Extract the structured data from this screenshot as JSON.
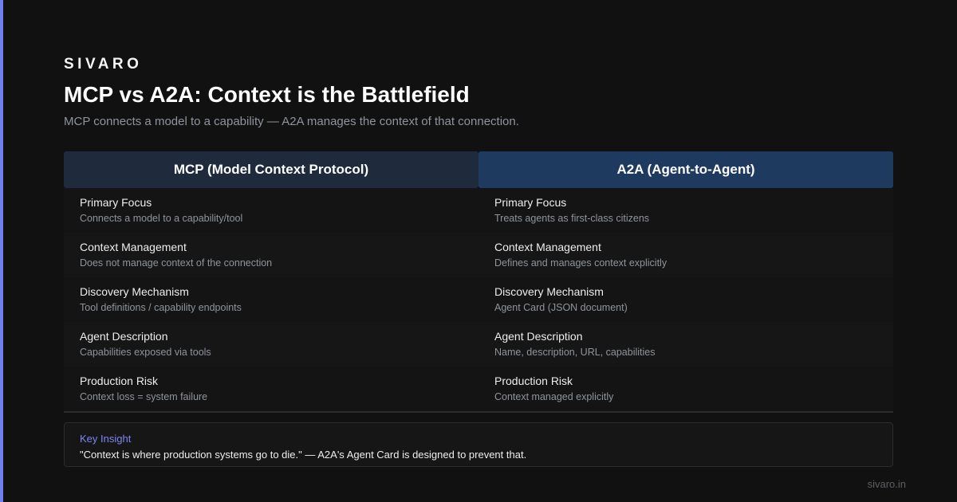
{
  "brand": "SIVARO",
  "title": "MCP vs A2A: Context is the Battlefield",
  "subtitle": "MCP connects a model to a capability — A2A manages the context of that connection.",
  "comparison": {
    "mcp": {
      "header": "MCP (Model Context Protocol)",
      "rows": [
        {
          "label": "Primary Focus",
          "value": "Connects a model to a capability/tool"
        },
        {
          "label": "Context Management",
          "value": "Does not manage context of the connection"
        },
        {
          "label": "Discovery Mechanism",
          "value": "Tool definitions / capability endpoints"
        },
        {
          "label": "Agent Description",
          "value": "Capabilities exposed via tools"
        },
        {
          "label": "Production Risk",
          "value": "Context loss = system failure"
        }
      ]
    },
    "a2a": {
      "header": "A2A (Agent-to-Agent)",
      "rows": [
        {
          "label": "Primary Focus",
          "value": "Treats agents as first-class citizens"
        },
        {
          "label": "Context Management",
          "value": "Defines and manages context explicitly"
        },
        {
          "label": "Discovery Mechanism",
          "value": "Agent Card (JSON document)"
        },
        {
          "label": "Agent Description",
          "value": "Name, description, URL, capabilities"
        },
        {
          "label": "Production Risk",
          "value": "Context managed explicitly"
        }
      ]
    }
  },
  "insight": {
    "label": "Key Insight",
    "text": "\"Context is where production systems go to die.\" — A2A's Agent Card is designed to prevent that."
  },
  "footer": "sivaro.in",
  "colors": {
    "accent": "#6f7ef0",
    "mcp_header_bg": "#1f2a3c",
    "a2a_header_bg": "#1f3a5f",
    "insight_label": "#7b87ef",
    "background": "#111111"
  }
}
